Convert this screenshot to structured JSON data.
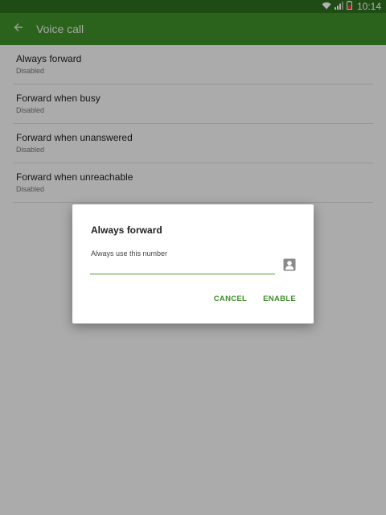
{
  "status_bar": {
    "time": "10:14",
    "icons": [
      "wifi-icon",
      "signal-icon",
      "battery-icon"
    ],
    "background": "#2b6e1e"
  },
  "app_bar": {
    "title": "Voice call",
    "back_icon": "arrow-back-icon",
    "background": "#3e8f2a"
  },
  "list": {
    "items": [
      {
        "title": "Always forward",
        "subtitle": "Disabled"
      },
      {
        "title": "Forward when busy",
        "subtitle": "Disabled"
      },
      {
        "title": "Forward when unanswered",
        "subtitle": "Disabled"
      },
      {
        "title": "Forward when unreachable",
        "subtitle": "Disabled"
      }
    ]
  },
  "dialog": {
    "title": "Always forward",
    "field_label": "Always use this number",
    "field_value": "",
    "contact_icon": "contact-icon",
    "cancel_label": "CANCEL",
    "enable_label": "ENABLE",
    "accent_color": "#3f8f2a"
  }
}
